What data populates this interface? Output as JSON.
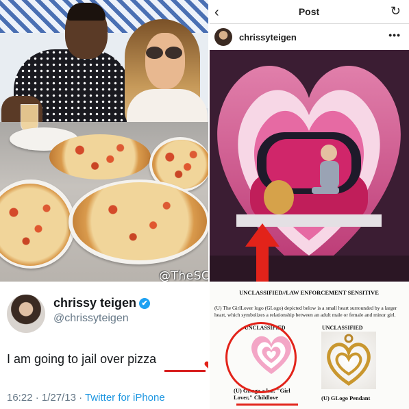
{
  "photo": {
    "watermark": "@TheSCIF"
  },
  "instagram": {
    "back_icon": "chevron-left-icon",
    "title": "Post",
    "refresh_icon": "refresh-icon",
    "username": "chrissyteigen",
    "more": "•••"
  },
  "tweet": {
    "name": "chrissy teigen",
    "verified_mark": "✔",
    "handle": "@chrissyteigen",
    "text": "I am going to jail over pizza",
    "time_date": "16:22 · 1/27/13 · ",
    "source": "Twitter for iPhone"
  },
  "document": {
    "heading": "UNCLASSIFIED//LAW ENFORCEMENT SENSITIVE",
    "body": "(U) The GirlLover logo (GLogo) depicted below is a small heart surrounded by a larger heart, which symbolizes a relationship between an adult male or female and minor girl.",
    "label_left": "UNCLASSIFIED",
    "label_right": "UNCLASSIFIED",
    "caption_left": "(U) GLogo a.k.a. \"Girl Lover,\" Childlove",
    "caption_right": "(U) GLogo Pendant"
  },
  "colors": {
    "annotation_red": "#e2231a",
    "twitter_blue": "#1da1f2",
    "glogo_pink": "#f3a6c6"
  }
}
